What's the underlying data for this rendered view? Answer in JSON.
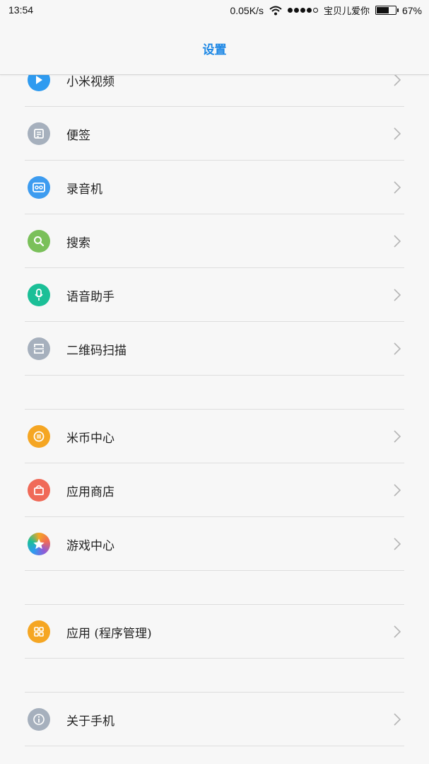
{
  "status": {
    "time": "13:54",
    "speed": "0.05K/s",
    "carrier": "宝贝儿爱你",
    "battery": "67%",
    "battery_level": 0.67
  },
  "header": {
    "title": "设置"
  },
  "colors": {
    "accent": "#1e88e5"
  },
  "items": [
    {
      "label": "小米视频",
      "icon": "play-icon",
      "color": "#2f9bf0"
    },
    {
      "label": "便签",
      "icon": "notes-icon",
      "color": "#a6b0bd"
    },
    {
      "label": "录音机",
      "icon": "recorder-icon",
      "color": "#3d9cf0"
    },
    {
      "label": "搜索",
      "icon": "search-icon",
      "color": "#7ac05a"
    },
    {
      "label": "语音助手",
      "icon": "microphone-icon",
      "color": "#1bbf97"
    },
    {
      "label": "二维码扫描",
      "icon": "qr-scan-icon",
      "color": "#a6b0bd"
    },
    {
      "label": "米币中心",
      "icon": "coin-icon",
      "color": "#f5a623"
    },
    {
      "label": "应用商店",
      "icon": "shopping-bag-icon",
      "color": "#f06a58"
    },
    {
      "label": "游戏中心",
      "icon": "star-icon",
      "color": "#8e5bd8"
    },
    {
      "label": "应用 (程序管理)",
      "icon": "apps-grid-icon",
      "color": "#f5a623"
    },
    {
      "label": "关于手机",
      "icon": "info-icon",
      "color": "#a6b0bd"
    }
  ]
}
